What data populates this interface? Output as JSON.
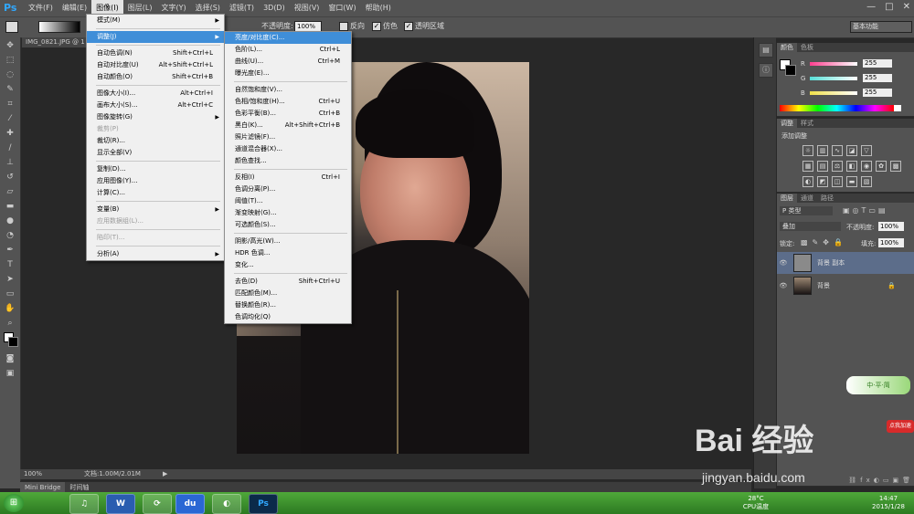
{
  "menubar": {
    "logo": "Ps",
    "items": [
      "文件(F)",
      "编辑(E)",
      "图像(I)",
      "图层(L)",
      "文字(Y)",
      "选择(S)",
      "滤镜(T)",
      "3D(D)",
      "视图(V)",
      "窗口(W)",
      "帮助(H)"
    ],
    "active_index": 2,
    "window_buttons": [
      "—",
      "□",
      "✕"
    ]
  },
  "options": {
    "opacity_label": "不透明度:",
    "opacity_value": "100%",
    "reverse_label": "反向",
    "dither_label": "仿色",
    "transparency_label": "透明区域",
    "workspace": "基本功能"
  },
  "document": {
    "tab_title": "IMG_0821.JPG @ 1",
    "zoom": "100%",
    "doc_info": "文档:1.00M/2.01M"
  },
  "bridge": {
    "tabs": [
      "Mini Bridge",
      "时间轴"
    ]
  },
  "image_menu": {
    "items": [
      {
        "label": "模式(M)",
        "shortcut": "",
        "submenu": true,
        "disabled": false,
        "highlight": false
      },
      {
        "sep": true
      },
      {
        "label": "调整(J)",
        "shortcut": "",
        "submenu": true,
        "disabled": false,
        "highlight": true
      },
      {
        "sep": true
      },
      {
        "label": "自动色调(N)",
        "shortcut": "Shift+Ctrl+L",
        "submenu": false,
        "disabled": false,
        "highlight": false
      },
      {
        "label": "自动对比度(U)",
        "shortcut": "Alt+Shift+Ctrl+L",
        "submenu": false,
        "disabled": false,
        "highlight": false
      },
      {
        "label": "自动颜色(O)",
        "shortcut": "Shift+Ctrl+B",
        "submenu": false,
        "disabled": false,
        "highlight": false
      },
      {
        "sep": true
      },
      {
        "label": "图像大小(I)...",
        "shortcut": "Alt+Ctrl+I",
        "submenu": false,
        "disabled": false,
        "highlight": false
      },
      {
        "label": "画布大小(S)...",
        "shortcut": "Alt+Ctrl+C",
        "submenu": false,
        "disabled": false,
        "highlight": false
      },
      {
        "label": "图像旋转(G)",
        "shortcut": "",
        "submenu": true,
        "disabled": false,
        "highlight": false
      },
      {
        "label": "裁剪(P)",
        "shortcut": "",
        "submenu": false,
        "disabled": true,
        "highlight": false
      },
      {
        "label": "裁切(R)...",
        "shortcut": "",
        "submenu": false,
        "disabled": false,
        "highlight": false
      },
      {
        "label": "显示全部(V)",
        "shortcut": "",
        "submenu": false,
        "disabled": false,
        "highlight": false
      },
      {
        "sep": true
      },
      {
        "label": "复制(D)...",
        "shortcut": "",
        "submenu": false,
        "disabled": false,
        "highlight": false
      },
      {
        "label": "应用图像(Y)...",
        "shortcut": "",
        "submenu": false,
        "disabled": false,
        "highlight": false
      },
      {
        "label": "计算(C)...",
        "shortcut": "",
        "submenu": false,
        "disabled": false,
        "highlight": false
      },
      {
        "sep": true
      },
      {
        "label": "变量(B)",
        "shortcut": "",
        "submenu": true,
        "disabled": false,
        "highlight": false
      },
      {
        "label": "应用数据组(L)...",
        "shortcut": "",
        "submenu": false,
        "disabled": true,
        "highlight": false
      },
      {
        "sep": true
      },
      {
        "label": "陷印(T)...",
        "shortcut": "",
        "submenu": false,
        "disabled": true,
        "highlight": false
      },
      {
        "sep": true
      },
      {
        "label": "分析(A)",
        "shortcut": "",
        "submenu": true,
        "disabled": false,
        "highlight": false
      }
    ]
  },
  "adjust_menu": {
    "items": [
      {
        "label": "亮度/对比度(C)...",
        "shortcut": "",
        "highlight": true
      },
      {
        "label": "色阶(L)...",
        "shortcut": "Ctrl+L",
        "highlight": false
      },
      {
        "label": "曲线(U)...",
        "shortcut": "Ctrl+M",
        "highlight": false
      },
      {
        "label": "曝光度(E)...",
        "shortcut": "",
        "highlight": false
      },
      {
        "sep": true
      },
      {
        "label": "自然饱和度(V)...",
        "shortcut": "",
        "highlight": false
      },
      {
        "label": "色相/饱和度(H)...",
        "shortcut": "Ctrl+U",
        "highlight": false
      },
      {
        "label": "色彩平衡(B)...",
        "shortcut": "Ctrl+B",
        "highlight": false
      },
      {
        "label": "黑白(K)...",
        "shortcut": "Alt+Shift+Ctrl+B",
        "highlight": false
      },
      {
        "label": "照片滤镜(F)...",
        "shortcut": "",
        "highlight": false
      },
      {
        "label": "通道混合器(X)...",
        "shortcut": "",
        "highlight": false
      },
      {
        "label": "颜色查找...",
        "shortcut": "",
        "highlight": false
      },
      {
        "sep": true
      },
      {
        "label": "反相(I)",
        "shortcut": "Ctrl+I",
        "highlight": false
      },
      {
        "label": "色调分离(P)...",
        "shortcut": "",
        "highlight": false
      },
      {
        "label": "阈值(T)...",
        "shortcut": "",
        "highlight": false
      },
      {
        "label": "渐变映射(G)...",
        "shortcut": "",
        "highlight": false
      },
      {
        "label": "可选颜色(S)...",
        "shortcut": "",
        "highlight": false
      },
      {
        "sep": true
      },
      {
        "label": "阴影/高光(W)...",
        "shortcut": "",
        "highlight": false
      },
      {
        "label": "HDR 色调...",
        "shortcut": "",
        "highlight": false
      },
      {
        "label": "变化...",
        "shortcut": "",
        "highlight": false
      },
      {
        "sep": true
      },
      {
        "label": "去色(D)",
        "shortcut": "Shift+Ctrl+U",
        "highlight": false
      },
      {
        "label": "匹配颜色(M)...",
        "shortcut": "",
        "highlight": false
      },
      {
        "label": "替换颜色(R)...",
        "shortcut": "",
        "highlight": false
      },
      {
        "label": "色调均化(Q)",
        "shortcut": "",
        "highlight": false
      }
    ]
  },
  "color_panel": {
    "tabs": [
      "颜色",
      "色板"
    ],
    "channels": [
      {
        "label": "R",
        "value": "255",
        "color": "#ff3f8f"
      },
      {
        "label": "G",
        "value": "255",
        "color": "#58e0d8"
      },
      {
        "label": "B",
        "value": "255",
        "color": "#f0e04a"
      }
    ]
  },
  "adjust_panel": {
    "tabs": [
      "调整",
      "样式"
    ],
    "title": "添加调整"
  },
  "layers_panel": {
    "tabs": [
      "图层",
      "通道",
      "路径"
    ],
    "kind_label": "P 类型",
    "blend_mode": "叠加",
    "opacity_label": "不透明度:",
    "opacity_value": "100%",
    "lock_label": "锁定:",
    "fill_label": "填充:",
    "fill_value": "100%",
    "layers": [
      {
        "name": "背景 副本",
        "selected": true
      },
      {
        "name": "背景",
        "selected": false
      }
    ]
  },
  "widget": {
    "label": "中·平·简",
    "hint": "点我加速"
  },
  "taskbar": {
    "start": "⊞",
    "apps": [
      "♫",
      "W",
      "⟳",
      "du",
      "◐",
      "Ps"
    ],
    "tray_weather": "28°C",
    "tray_weather_sub": "CPU温度",
    "time": "14:47",
    "date": "2015/1/28"
  },
  "watermark": {
    "brand": "Bai 经验",
    "url": "jingyan.baidu.com"
  }
}
